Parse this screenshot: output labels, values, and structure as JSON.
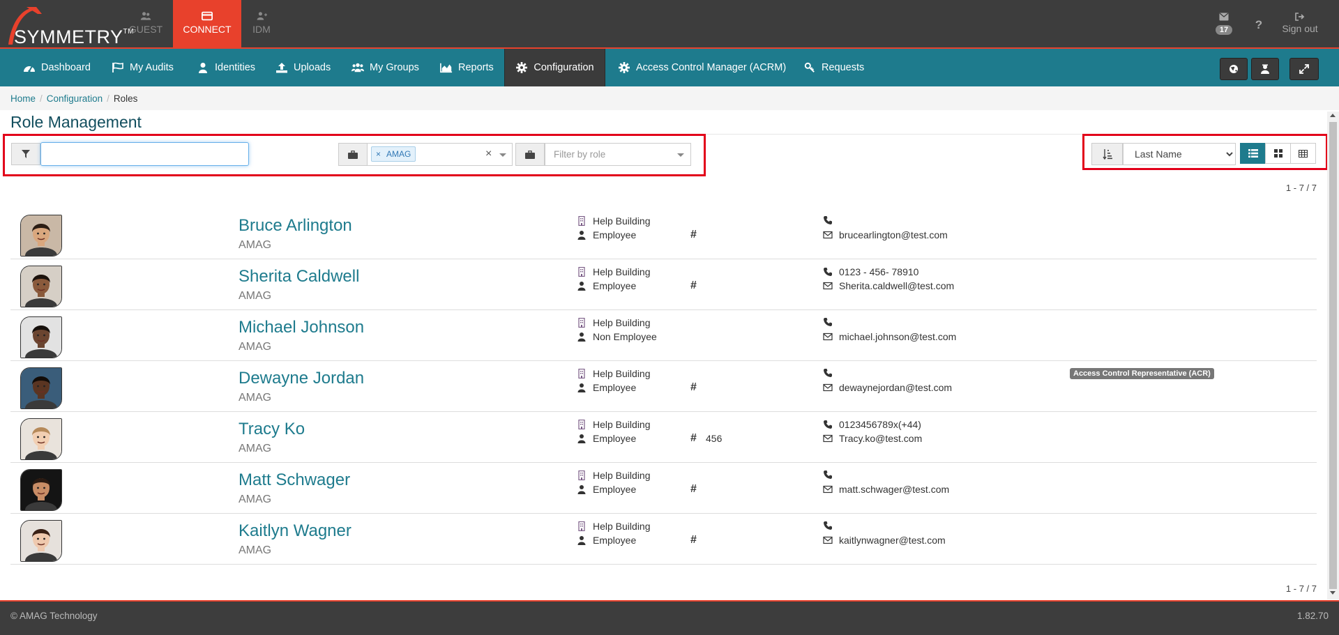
{
  "app": {
    "brand": "SYMMETRY",
    "brand_tm": "TM",
    "tabs": [
      {
        "label": "GUEST",
        "icon": "users-icon"
      },
      {
        "label": "CONNECT",
        "icon": "card-icon"
      },
      {
        "label": "IDM",
        "icon": "user-plus-icon"
      }
    ],
    "mail_count": "17",
    "help_label": "?",
    "signout_label": "Sign out"
  },
  "nav": {
    "items": [
      {
        "label": "Dashboard",
        "icon": "dashboard-icon"
      },
      {
        "label": "My Audits",
        "icon": "flag-icon"
      },
      {
        "label": "Identities",
        "icon": "user-icon"
      },
      {
        "label": "Uploads",
        "icon": "upload-icon"
      },
      {
        "label": "My Groups",
        "icon": "group-icon"
      },
      {
        "label": "Reports",
        "icon": "area-chart-icon"
      },
      {
        "label": "Configuration",
        "icon": "gear-icon"
      },
      {
        "label": "Access Control Manager (ACRM)",
        "icon": "gear-icon"
      },
      {
        "label": "Requests",
        "icon": "key-icon"
      }
    ],
    "active": "Configuration"
  },
  "breadcrumb": [
    "Home",
    "Configuration",
    "Roles"
  ],
  "page_title": "Role Management",
  "filters": {
    "search_value": "",
    "company_tag": "AMAG",
    "company_tag_remove": "×",
    "company_clear": "×",
    "role_placeholder": "Filter by role",
    "sort_by": "Last Name",
    "sort_options": [
      "Last Name"
    ]
  },
  "range_top": "1 - 7 / 7",
  "range_bottom": "1 - 7 / 7",
  "people": [
    {
      "name": "Bruce Arlington",
      "company": "AMAG",
      "building": "Help Building",
      "type": "Employee",
      "hash": "#",
      "hash_value": "",
      "phone": "",
      "email": "brucearlington@test.com",
      "skin": "#d9a77e",
      "hair": "#2b1d14",
      "bg": "#c9b8a6"
    },
    {
      "name": "Sherita Caldwell",
      "company": "AMAG",
      "building": "Help Building",
      "type": "Employee",
      "hash": "#",
      "hash_value": "",
      "phone": "0123 - 456- 78910",
      "email": "Sherita.caldwell@test.com",
      "skin": "#8a5a3c",
      "hair": "#1c120c",
      "bg": "#d6cfc6"
    },
    {
      "name": "Michael Johnson",
      "company": "AMAG",
      "building": "Help Building",
      "type": "Non Employee",
      "hash": "",
      "hash_value": "",
      "phone": "",
      "email": "michael.johnson@test.com",
      "skin": "#6b4530",
      "hair": "#16100c",
      "bg": "#e2e2e2"
    },
    {
      "name": "Dewayne Jordan",
      "company": "AMAG",
      "building": "Help Building",
      "type": "Employee",
      "hash": "#",
      "hash_value": "",
      "phone": "",
      "email": "dewaynejordan@test.com",
      "skin": "#5a3522",
      "hair": "#120c08",
      "bg": "#3a5d7a",
      "role_badge": "Access Control Representative (ACR)"
    },
    {
      "name": "Tracy Ko",
      "company": "AMAG",
      "building": "Help Building",
      "type": "Employee",
      "hash": "#",
      "hash_value": "456",
      "phone": "0123456789x(+44)",
      "email": "Tracy.ko@test.com",
      "skin": "#f2cfb2",
      "hair": "#b68a5a",
      "bg": "#e9e3dc"
    },
    {
      "name": "Matt Schwager",
      "company": "AMAG",
      "building": "Help Building",
      "type": "Employee",
      "hash": "#",
      "hash_value": "",
      "phone": "",
      "email": "matt.schwager@test.com",
      "skin": "#c98d66",
      "hair": "#2a1a12",
      "bg": "#141414"
    },
    {
      "name": "Kaitlyn Wagner",
      "company": "AMAG",
      "building": "Help Building",
      "type": "Employee",
      "hash": "#",
      "hash_value": "",
      "phone": "",
      "email": "kaitlynwagner@test.com",
      "skin": "#efc9ae",
      "hair": "#3a2116",
      "bg": "#e6e1dc"
    }
  ],
  "footer": {
    "copyright": "© AMAG Technology",
    "version": "1.82.70"
  },
  "colors": {
    "accent_teal": "#1e7b8d",
    "brand_red": "#e8412c",
    "dark_bar": "#3d3d3d",
    "highlight_red": "#e2001a"
  }
}
